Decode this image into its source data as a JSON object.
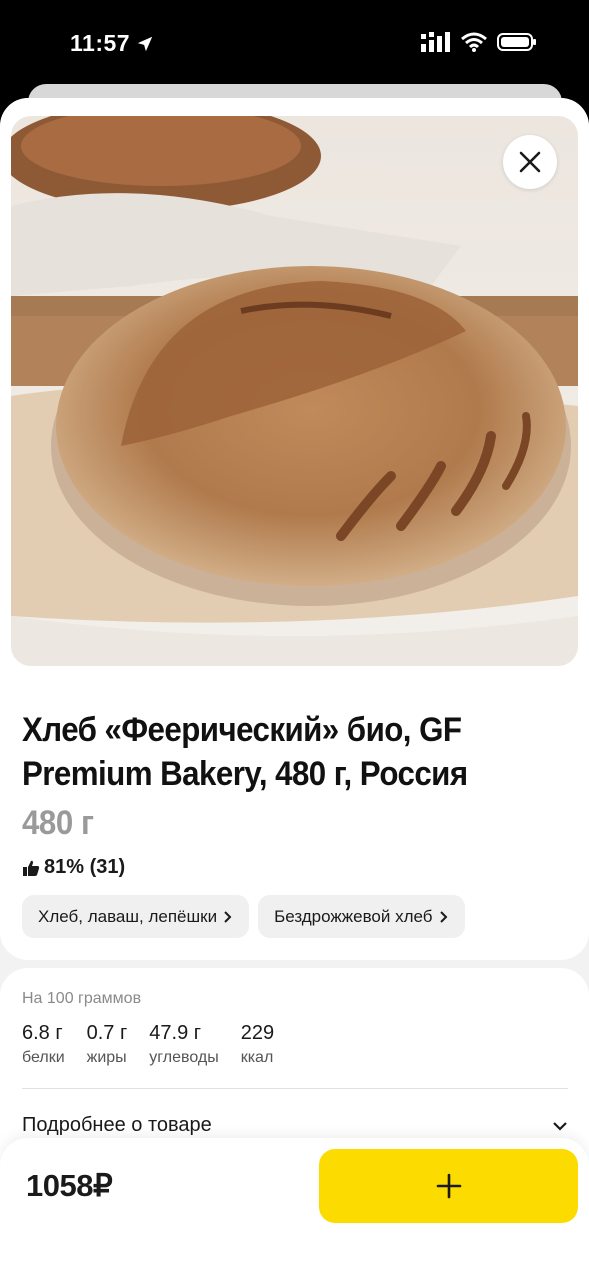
{
  "status_bar": {
    "time": "11:57"
  },
  "product": {
    "title": "Хлеб «Феерический» био, GF Premium Bakery, 480 г, Россия",
    "weight": "480 г",
    "rating": "81% (31)",
    "categories": [
      {
        "label": "Хлеб, лаваш, лепёшки"
      },
      {
        "label": "Бездрожжевой хлеб"
      }
    ]
  },
  "nutrition": {
    "header": "На 100 граммов",
    "items": [
      {
        "value": "6.8 г",
        "label": "белки"
      },
      {
        "value": "0.7 г",
        "label": "жиры"
      },
      {
        "value": "47.9 г",
        "label": "углеводы"
      },
      {
        "value": "229",
        "label": "ккал"
      }
    ]
  },
  "details": {
    "label": "Подробнее о товаре"
  },
  "purchase": {
    "price": "1058₽"
  },
  "colors": {
    "accent": "#fcdc00",
    "weight_gray": "#9a9a9a",
    "chip_bg": "#f0f0f0"
  },
  "icons": [
    "location-arrow-icon",
    "signal-icon",
    "wifi-icon",
    "battery-icon",
    "close-icon",
    "thumbs-up-icon",
    "chevron-right-icon",
    "chevron-down-icon",
    "plus-icon"
  ]
}
